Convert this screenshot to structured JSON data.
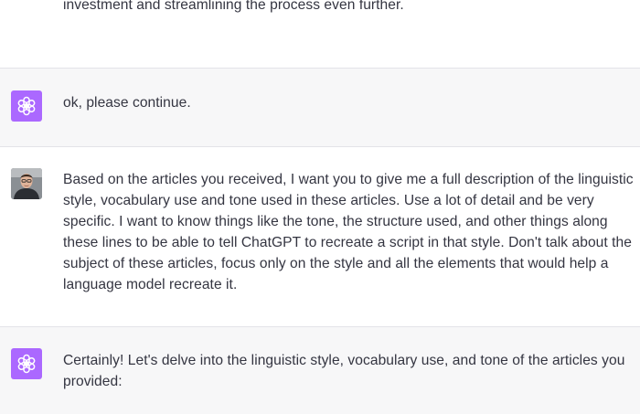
{
  "colors": {
    "assistant_bg": "#f7f7f8",
    "user_bg": "#ffffff",
    "assistant_avatar": "#ab68ff",
    "text": "#343541"
  },
  "messages": [
    {
      "role": "assistant",
      "avatar_icon": "openai-logo-icon",
      "text": "investment and streamlining the process even further."
    },
    {
      "role": "assistant",
      "avatar_icon": "openai-logo-icon",
      "text": "ok, please continue."
    },
    {
      "role": "user",
      "avatar_icon": "user-photo",
      "text": "Based on the articles you received, I want you to give me a full description of the linguistic style, vocabulary use and tone used in these articles. Use a lot of detail and be very specific. I want to know things like the tone, the structure used, and other things along these lines to be able to tell ChatGPT to recreate a script in that style. Don't talk about the subject of these articles, focus only on the style and all the elements that would help a language model recreate it."
    },
    {
      "role": "assistant",
      "avatar_icon": "openai-logo-icon",
      "text": "Certainly! Let's delve into the linguistic style, vocabulary use, and tone of the articles you provided:"
    }
  ]
}
